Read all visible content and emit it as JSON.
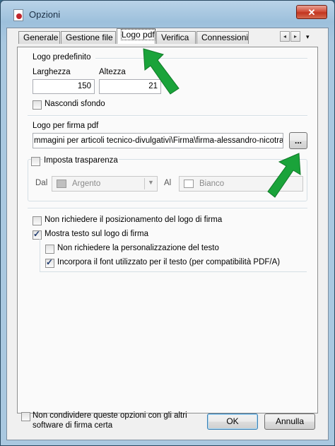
{
  "window": {
    "title": "Opzioni",
    "close_label": "✕"
  },
  "tabs": [
    {
      "label": "Generale"
    },
    {
      "label": "Gestione file"
    },
    {
      "label": "Logo pdf"
    },
    {
      "label": "Verifica"
    },
    {
      "label": "Connessioni"
    }
  ],
  "tab_scroll": {
    "left": "◂",
    "right": "▸",
    "menu": "▾"
  },
  "logo_predefinito": {
    "section_label": "Logo predefinito",
    "width_label": "Larghezza",
    "width_value": "150",
    "height_label": "Altezza",
    "height_value": "21",
    "hide_background_label": "Nascondi sfondo",
    "hide_background_checked": false
  },
  "logo_firma": {
    "section_label": "Logo per firma pdf",
    "path_value": "mmagini per articoli tecnico-divulgativi\\Firma\\firma-alessandro-nicotra.jpg",
    "browse_label": "..."
  },
  "trasparenza": {
    "label": "Imposta trasparenza",
    "checked": false,
    "from_label": "Dal",
    "from_value": "Argento",
    "from_color": "#c0c0c0",
    "to_label": "Al",
    "to_value": "Bianco",
    "to_color": "#ffffff"
  },
  "options": {
    "no_positioning_label": "Non richiedere il posizionamento del logo di firma",
    "no_positioning_checked": false,
    "show_text_label": "Mostra testo sul logo di firma",
    "show_text_checked": true,
    "no_customization_label": "Non richiedere la personalizzazione del testo",
    "no_customization_checked": false,
    "embed_font_label": "Incorpora il font utilizzato per il testo (per compatibilità PDF/A)",
    "embed_font_checked": true
  },
  "footer": {
    "share_label_line1": "Non condividere queste opzioni con gli altri",
    "share_label_line2": "software di firma certa",
    "share_checked": false,
    "ok_label": "OK",
    "cancel_label": "Annulla"
  },
  "colors": {
    "annotation_arrow": "#1aa33a",
    "close_button": "#c2351f"
  }
}
